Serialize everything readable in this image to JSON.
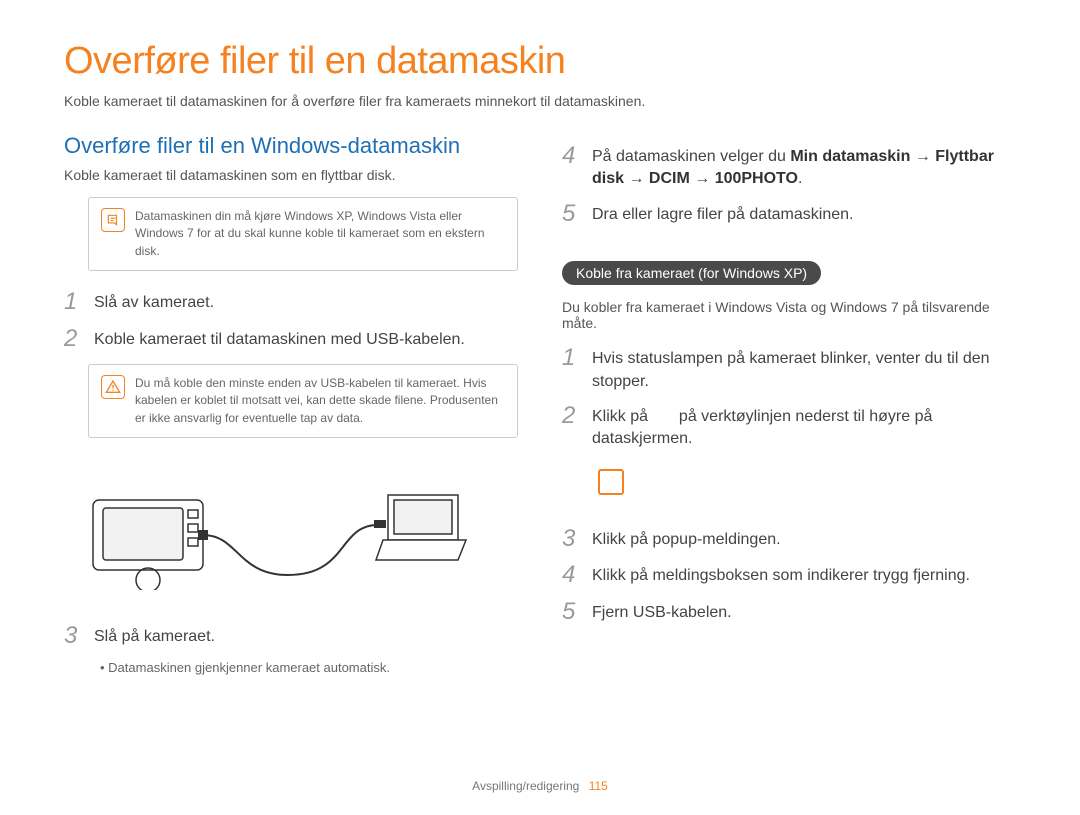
{
  "title": "Overføre filer til en datamaskin",
  "intro": "Koble kameraet til datamaskinen for å overføre filer fra kameraets minnekort til datamaskinen.",
  "left": {
    "heading": "Overføre filer til en Windows-datamaskin",
    "sub": "Koble kameraet til datamaskinen som en flyttbar disk.",
    "note": "Datamaskinen din må kjøre Windows XP, Windows Vista eller Windows 7 for at du skal kunne koble til kameraet som en ekstern disk.",
    "steps": {
      "1": "Slå av kameraet.",
      "2": "Koble kameraet til datamaskinen med USB-kabelen.",
      "3": "Slå på kameraet."
    },
    "warn": "Du må koble den minste enden av USB-kabelen til kameraet. Hvis kabelen er koblet til motsatt vei, kan dette skade filene. Produsenten er ikke ansvarlig for eventuelle tap av data.",
    "bullet3": "Datamaskinen gjenkjenner kameraet automatisk."
  },
  "right": {
    "step4_pre": "På datamaskinen velger du ",
    "step4_b1": "Min datamaskin",
    "arrow": " → ",
    "step4_b2": "Flyttbar disk",
    "step4_b3": "DCIM",
    "step4_b4": "100PHOTO",
    "step5": "Dra eller lagre filer på datamaskinen.",
    "pill": "Koble fra kameraet (for Windows XP)",
    "pill_sub": "Du kobler fra kameraet i Windows Vista og Windows 7 på tilsvarende måte.",
    "d_steps": {
      "1": "Hvis statuslampen på kameraet blinker, venter du til den stopper.",
      "2a": "Klikk på ",
      "2b": " på verktøylinjen nederst til høyre på dataskjermen.",
      "3": "Klikk på popup-meldingen.",
      "4": "Klikk på meldingsboksen som indikerer trygg fjerning.",
      "5": "Fjern USB-kabelen."
    }
  },
  "footer": {
    "label": "Avspilling/redigering",
    "page": "115"
  }
}
